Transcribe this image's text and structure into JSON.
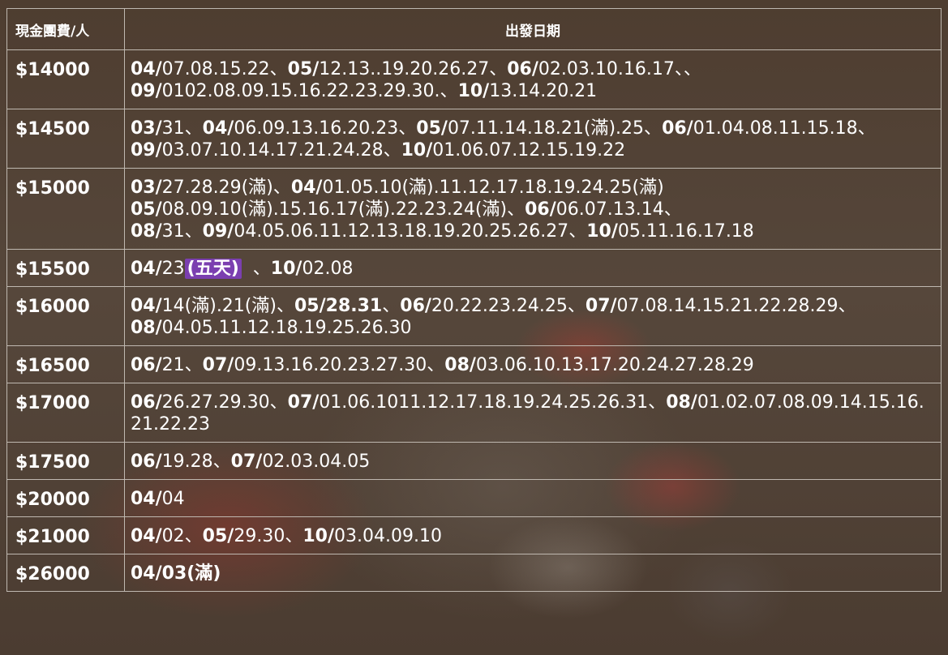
{
  "table": {
    "headers": [
      "現金團費/人",
      "出發日期"
    ],
    "rows": [
      {
        "price": "$14000",
        "lines": [
          [
            [
              "04/",
              "07.08.15.22"
            ],
            [
              "05/",
              "12.13..19.20.26.27"
            ],
            [
              "06/",
              "02.03.10.16.17"
            ],
            [
              "",
              "",
              "、"
            ]
          ],
          [
            [
              "09/",
              "0102.08.09.15.16.22.23.29.30."
            ],
            [
              "10/",
              "13.14.20.21",
              ""
            ]
          ]
        ]
      },
      {
        "price": "$14500",
        "lines": [
          [
            [
              "03/",
              "31"
            ],
            [
              "04/",
              "06.09.13.16.20.23"
            ],
            [
              "05/",
              "07.11.14.18.21(滿).25"
            ],
            [
              "06/",
              "01.04.08.11.15.18",
              "、"
            ]
          ],
          [
            [
              "09/",
              "03.07.10.14.17.21.24.28"
            ],
            [
              "10/",
              "01.06.07.12.15.19.22",
              ""
            ]
          ]
        ]
      },
      {
        "price": "$15000",
        "lines": [
          [
            [
              "03/",
              "27.28.29(滿)"
            ],
            [
              "04/",
              "01.05.10(滿).11.12.17.18.19.24.25(滿)",
              ""
            ]
          ],
          [
            [
              "05/",
              "08.09.10(滿).15.16.17(滿).22.23.24(滿)"
            ],
            [
              "06/",
              "06.07.13.14",
              "、"
            ]
          ],
          [
            [
              "08/",
              "31"
            ],
            [
              "09/",
              "04.05.06.11.12.13.18.19.20.25.26.27"
            ],
            [
              "10/",
              "05.11.16.17.18",
              ""
            ]
          ]
        ]
      },
      {
        "price": "$15500",
        "lines": [
          [
            [
              "04/",
              "23",
              "",
              {
                "tag": "(五天)"
              }
            ],
            [
              "10/",
              "02.08",
              ""
            ]
          ]
        ]
      },
      {
        "price": "$16000",
        "lines": [
          [
            [
              "04/",
              "14(滿).21(滿)"
            ],
            [
              "05/28.31",
              ""
            ],
            [
              "06/",
              "20.22.23.24.25"
            ],
            [
              "07/",
              "07.08.14.15.21.22.28.29",
              "、"
            ]
          ],
          [
            [
              "08/",
              "04.05.11.12.18.19.25.26.30",
              ""
            ]
          ]
        ]
      },
      {
        "price": "$16500",
        "lines": [
          [
            [
              "06/",
              "21"
            ],
            [
              "07/",
              "09.13.16.20.23.27.30"
            ],
            [
              "08/",
              "03.06.10.13.17.20.24.27.28.29",
              ""
            ]
          ]
        ]
      },
      {
        "price": "$17000",
        "lines": [
          [
            [
              "06/",
              "26.27.29.30"
            ],
            [
              "07/",
              "01.06.1011.12.17.18.19.24.25.26.31"
            ],
            [
              "08/",
              "01.02.07.08.09.14.15.16.",
              ""
            ]
          ],
          [
            [
              "",
              "21.22.23",
              ""
            ]
          ]
        ]
      },
      {
        "price": "$17500",
        "lines": [
          [
            [
              "06/",
              "19.28"
            ],
            [
              "07/",
              "02.03.04.05",
              ""
            ]
          ]
        ]
      },
      {
        "price": "$20000",
        "lines": [
          [
            [
              "04/",
              "04",
              ""
            ]
          ]
        ]
      },
      {
        "price": "$21000",
        "lines": [
          [
            [
              "04/",
              "02"
            ],
            [
              "05/",
              "29.30"
            ],
            [
              "10/",
              "03.04.09.10",
              ""
            ]
          ]
        ]
      },
      {
        "price": "$26000",
        "lines": [
          [
            [
              "04/03(滿)",
              "",
              ""
            ]
          ]
        ]
      }
    ]
  }
}
